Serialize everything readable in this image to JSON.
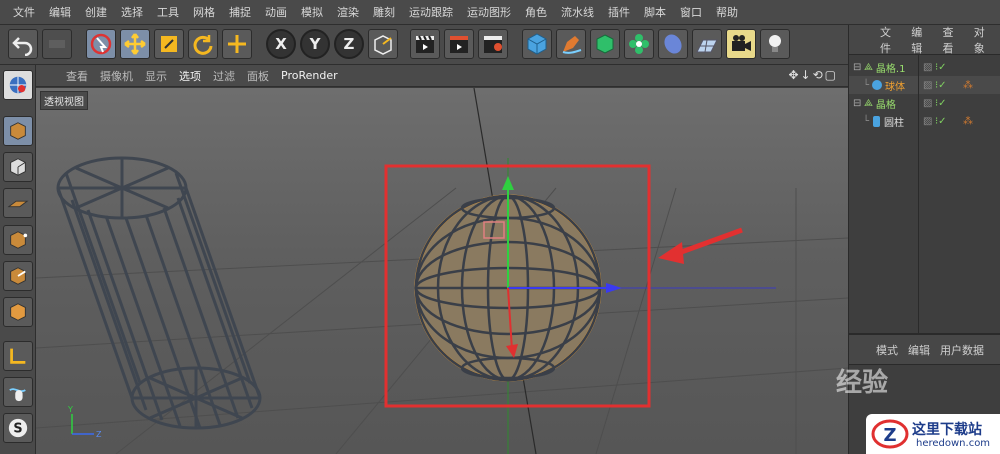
{
  "menu": [
    "文件",
    "编辑",
    "创建",
    "选择",
    "工具",
    "网格",
    "捕捉",
    "动画",
    "模拟",
    "渲染",
    "雕刻",
    "运动跟踪",
    "运动图形",
    "角色",
    "流水线",
    "插件",
    "脚本",
    "窗口",
    "帮助"
  ],
  "toolbar": {
    "undo": "undo-icon",
    "x_label": "X",
    "y_label": "Y",
    "z_label": "Z"
  },
  "viewport_menu": [
    "查看",
    "摄像机",
    "显示",
    "选项",
    "过滤",
    "面板",
    "ProRender"
  ],
  "viewport_label": "透视视图",
  "objects_menu": [
    "文件",
    "编辑",
    "查看",
    "对象"
  ],
  "objects": [
    {
      "name": "晶格.1",
      "indent": 0
    },
    {
      "name": "球体",
      "indent": 1
    },
    {
      "name": "晶格",
      "indent": 0
    },
    {
      "name": "圆柱",
      "indent": 1
    }
  ],
  "attributes_menu": [
    "模式",
    "编辑",
    "用户数据"
  ],
  "watermark": "经验",
  "logo": {
    "title": "这里下载站",
    "url": "heredown.com"
  },
  "axis_labels": {
    "y": "Y",
    "z": "Z"
  },
  "colors": {
    "accent_green": "#9adf6e",
    "selected": "#f0a030",
    "highlight_box": "#e23030"
  }
}
